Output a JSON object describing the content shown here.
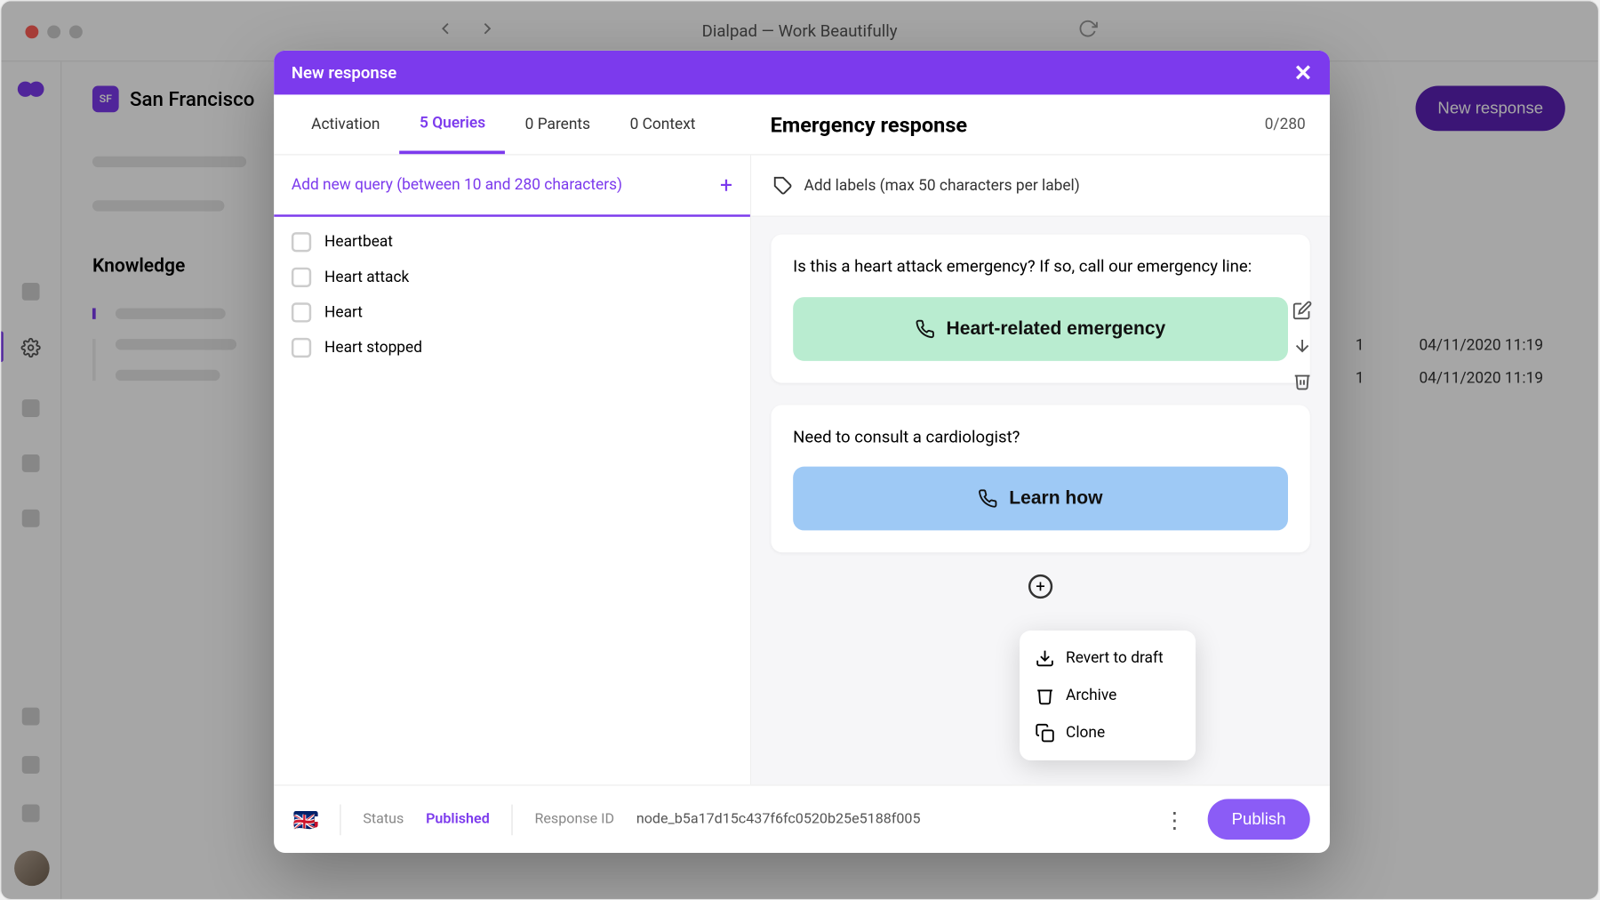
{
  "window": {
    "title": "Dialpad — Work Beautifully"
  },
  "sidebar": {
    "org_badge": "SF",
    "org_name": "San Francisco",
    "section_title": "Knowledge"
  },
  "main": {
    "new_response_btn": "New response",
    "rows": [
      {
        "count": "1",
        "ts": "04/11/2020 11:19"
      },
      {
        "count": "1",
        "ts": "04/11/2020 11:19"
      }
    ]
  },
  "modal": {
    "header": "New response",
    "tabs": {
      "activation": "Activation",
      "queries": "5 Queries",
      "parents": "0 Parents",
      "context": "0 Context"
    },
    "response_title": "Emergency response",
    "char_count": "0/280",
    "query_input_placeholder": "Add new query (between 10 and 280 characters)",
    "queries": [
      "Heartbeat",
      "Heart attack",
      "Heart",
      "Heart stopped"
    ],
    "add_labels_text": "Add labels (max 50 characters per label)",
    "cards": [
      {
        "text": "Is this a heart attack emergency? If so, call our emergency line:",
        "button": "Heart-related emergency"
      },
      {
        "text": "Need to consult a cardiologist?",
        "button": "Learn how"
      }
    ],
    "context_menu": {
      "revert": "Revert to draft",
      "archive": "Archive",
      "clone": "Clone"
    },
    "footer": {
      "status_label": "Status",
      "status_value": "Published",
      "response_id_label": "Response ID",
      "response_id_value": "node_b5a17d15c437f6fc0520b25e5188f005",
      "publish": "Publish"
    }
  }
}
